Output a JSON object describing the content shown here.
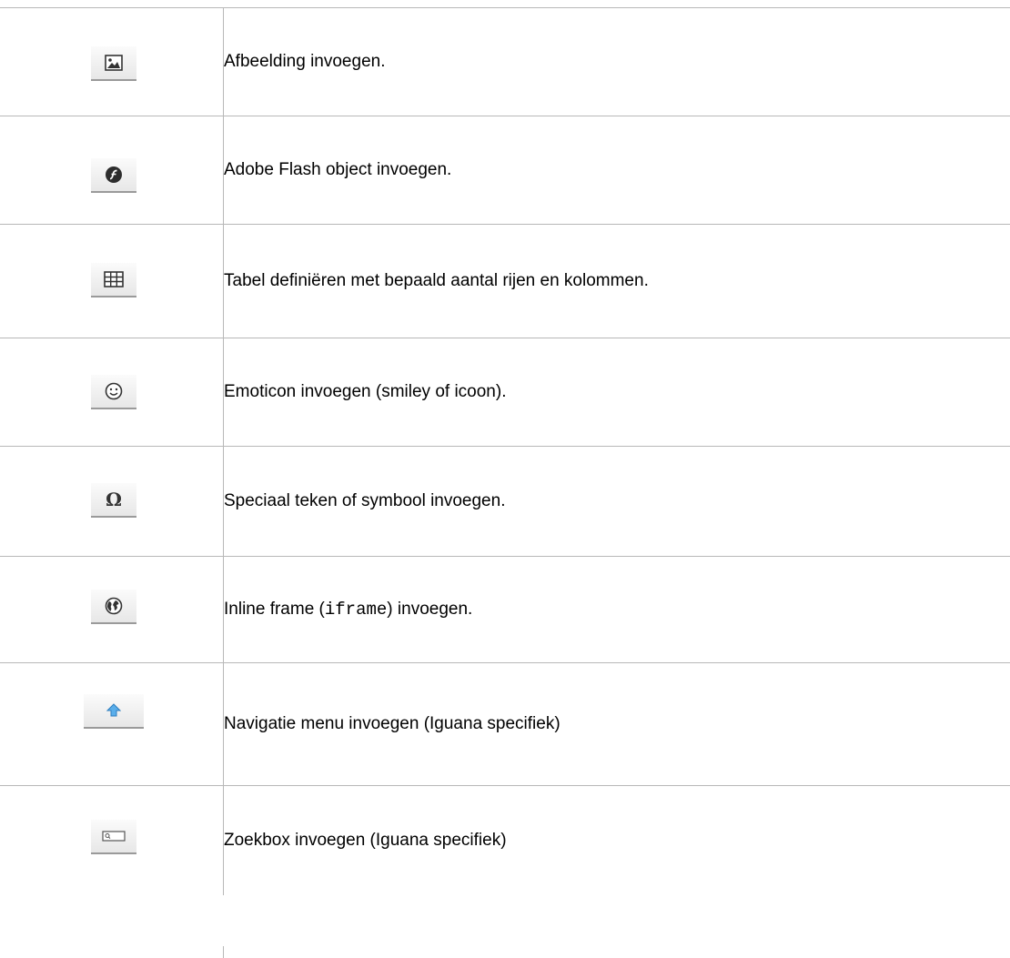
{
  "rows": [
    {
      "icon": "image-icon",
      "text": "Afbeelding invoegen."
    },
    {
      "icon": "flash-icon",
      "text": "Adobe Flash object invoegen."
    },
    {
      "icon": "table-icon",
      "text": "Tabel definiëren met bepaald aantal rijen en kolommen."
    },
    {
      "icon": "smiley-icon",
      "text": "Emoticon invoegen (smiley of icoon)."
    },
    {
      "icon": "omega-icon",
      "text": "Speciaal teken of symbool invoegen."
    },
    {
      "icon": "globe-icon",
      "text_before": "Inline frame (",
      "code": "iframe",
      "text_after": ") invoegen."
    },
    {
      "icon": "arrow-up-icon",
      "text": "Navigatie menu invoegen (Iguana specifiek)"
    },
    {
      "icon": "searchbox-icon",
      "text": "Zoekbox invoegen (Iguana specifiek)"
    }
  ],
  "colors": {
    "border": "#b8b8b8",
    "button_bg": "#f0f0f0",
    "arrow_blue": "#4a9fe0"
  }
}
